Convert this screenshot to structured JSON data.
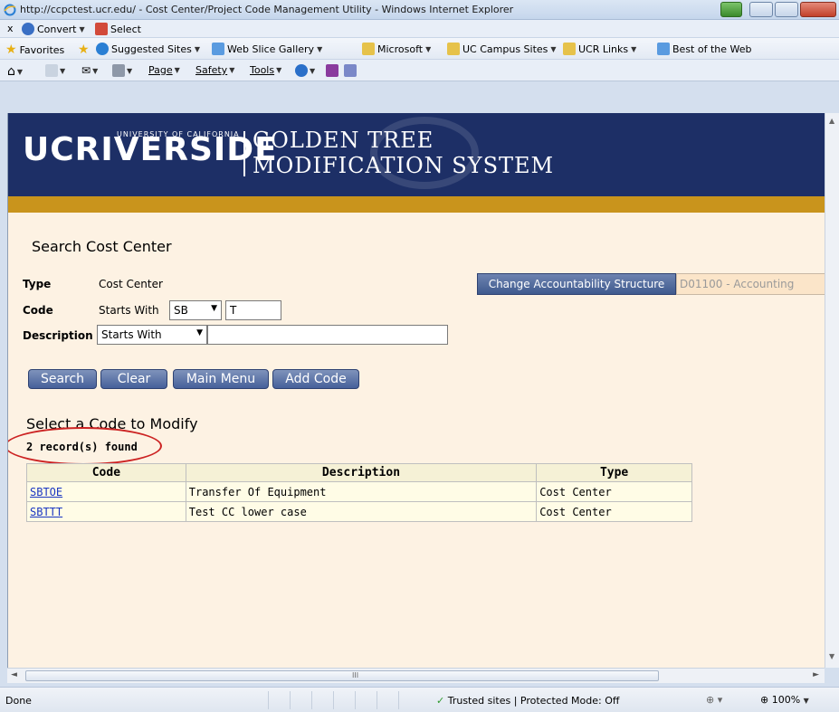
{
  "window": {
    "title": "http://ccpctest.ucr.edu/ - Cost Center/Project Code Management Utility - Windows Internet Explorer"
  },
  "command_bar": {
    "close": "x",
    "convert": "Convert",
    "select": "Select"
  },
  "favorites_bar": {
    "favorites": "Favorites",
    "items": [
      "Suggested Sites",
      "Web Slice Gallery",
      "Microsoft",
      "UC Campus Sites",
      "UCR Links",
      "Best of the Web"
    ]
  },
  "toolbar": {
    "page": "Page",
    "safety": "Safety",
    "tools": "Tools"
  },
  "banner": {
    "ucr": "UCRIVERSIDE",
    "university": "UNIVERSITY OF CALIFORNIA",
    "line1": "GOLDEN TREE",
    "line2": "MODIFICATION SYSTEM"
  },
  "search": {
    "heading": "Search Cost Center",
    "type_label": "Type",
    "type_value": "Cost Center",
    "code_label": "Code",
    "code_mode": "Starts With",
    "code_prefix": "SB",
    "code_value": "T",
    "desc_label": "Description",
    "desc_mode": "Starts With",
    "desc_value": "",
    "change_button": "Change Accountability Structure",
    "accountability": "D01100 - Accounting"
  },
  "buttons": {
    "search": "Search",
    "clear": "Clear",
    "main_menu": "Main Menu",
    "add_code": "Add Code"
  },
  "results": {
    "heading": "Select a Code to Modify",
    "count": "2 record(s) found",
    "columns": [
      "Code",
      "Description",
      "Type"
    ],
    "rows": [
      {
        "code": "SBTOE",
        "description": "Transfer Of Equipment",
        "type": "Cost Center"
      },
      {
        "code": "SBTTT",
        "description": "Test CC lower case",
        "type": "Cost Center"
      }
    ]
  },
  "scrollbar": {
    "grip": "III"
  },
  "status": {
    "done": "Done",
    "zone": "Trusted sites | Protected Mode: Off",
    "zoom": "100%"
  },
  "colors": {
    "banner": "#1d2f66",
    "gold": "#c9941c",
    "page_bg": "#fdf2e3",
    "button": "#46609a",
    "highlight_oval": "#cc2222"
  }
}
